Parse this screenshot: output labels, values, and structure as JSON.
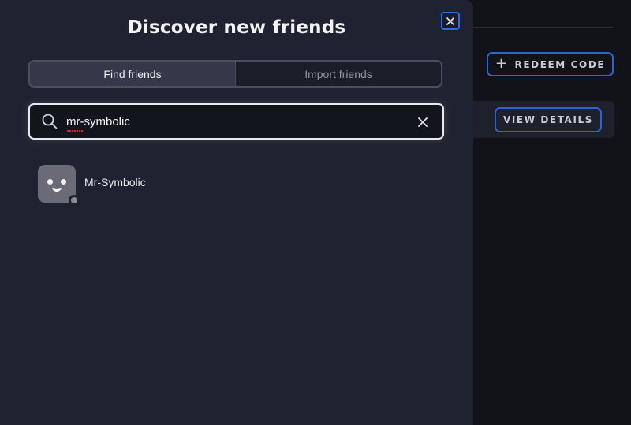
{
  "background": {
    "redeem_button": {
      "label": "REDEEM CODE",
      "icon": "plus-icon"
    },
    "view_details_button": {
      "label": "VIEW DETAILS"
    }
  },
  "modal": {
    "title": "Discover new friends",
    "close_icon": "close-icon",
    "tabs": [
      {
        "label": "Find friends",
        "active": true
      },
      {
        "label": "Import friends",
        "active": false
      }
    ],
    "search": {
      "value": "mr-symbolic",
      "placeholder": "",
      "icon": "search-icon",
      "clear_icon": "clear-icon"
    },
    "results": [
      {
        "username": "Mr-Symbolic",
        "status": "offline",
        "status_color": "#8b8d96"
      }
    ]
  },
  "colors": {
    "accent": "#2f6ae6",
    "modal_bg": "#1f2230",
    "page_bg": "#111318"
  }
}
